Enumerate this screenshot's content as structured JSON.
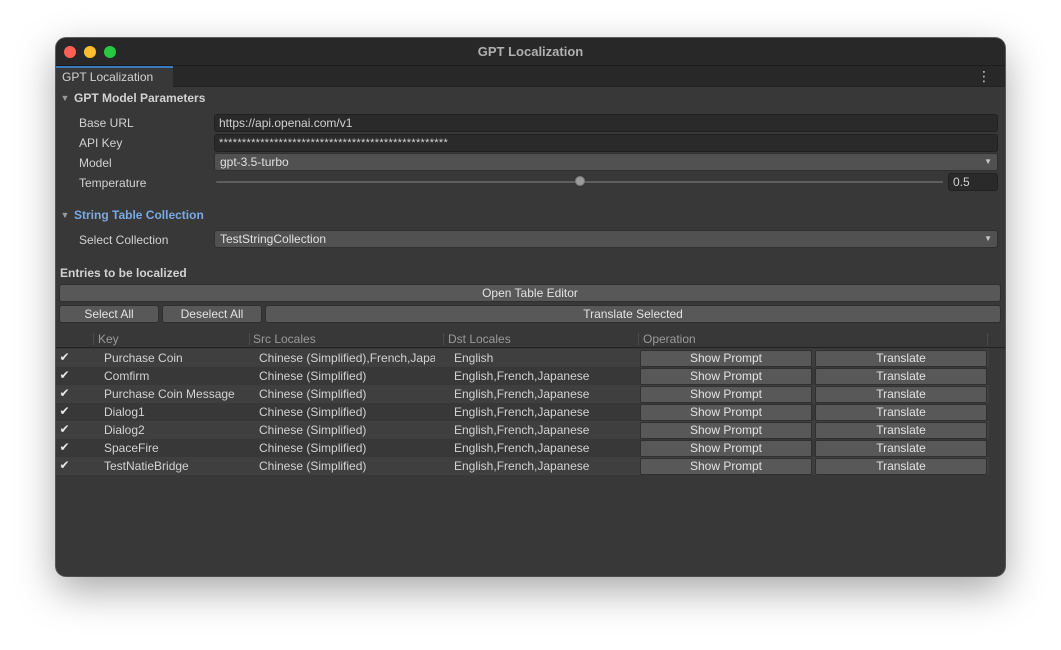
{
  "window": {
    "title": "GPT Localization"
  },
  "tab": {
    "label": "GPT Localization"
  },
  "model_section": {
    "header": "GPT Model Parameters",
    "base_url_label": "Base URL",
    "base_url_value": "https://api.openai.com/v1",
    "api_key_label": "API Key",
    "api_key_value": "**************************************************",
    "model_label": "Model",
    "model_value": "gpt-3.5-turbo",
    "temperature_label": "Temperature",
    "temperature_value": "0.5",
    "temperature_slider_fraction": 0.5
  },
  "collection_section": {
    "header": "String Table Collection",
    "select_label": "Select Collection",
    "select_value": "TestStringCollection"
  },
  "entries": {
    "label": "Entries to be localized",
    "open_table_editor": "Open Table Editor",
    "select_all": "Select All",
    "deselect_all": "Deselect All",
    "translate_selected": "Translate Selected",
    "columns": {
      "key": "Key",
      "src": "Src Locales",
      "dst": "Dst Locales",
      "op": "Operation"
    },
    "show_prompt_label": "Show Prompt",
    "translate_label": "Translate",
    "rows": [
      {
        "checked": true,
        "key": "Purchase Coin",
        "src": "Chinese (Simplified),French,Japanese",
        "dst": "English"
      },
      {
        "checked": true,
        "key": "Comfirm",
        "src": "Chinese (Simplified)",
        "dst": "English,French,Japanese"
      },
      {
        "checked": true,
        "key": "Purchase Coin Message",
        "src": "Chinese (Simplified)",
        "dst": "English,French,Japanese"
      },
      {
        "checked": true,
        "key": "Dialog1",
        "src": "Chinese (Simplified)",
        "dst": "English,French,Japanese"
      },
      {
        "checked": true,
        "key": "Dialog2",
        "src": "Chinese (Simplified)",
        "dst": "English,French,Japanese"
      },
      {
        "checked": true,
        "key": "SpaceFire",
        "src": "Chinese (Simplified)",
        "dst": "English,French,Japanese"
      },
      {
        "checked": true,
        "key": "TestNatieBridge",
        "src": "Chinese (Simplified)",
        "dst": "English,French,Japanese"
      }
    ]
  },
  "colors": {
    "accent": "#3a79bb",
    "section_blue": "#7aa9e0",
    "panel_bg": "#383838"
  }
}
